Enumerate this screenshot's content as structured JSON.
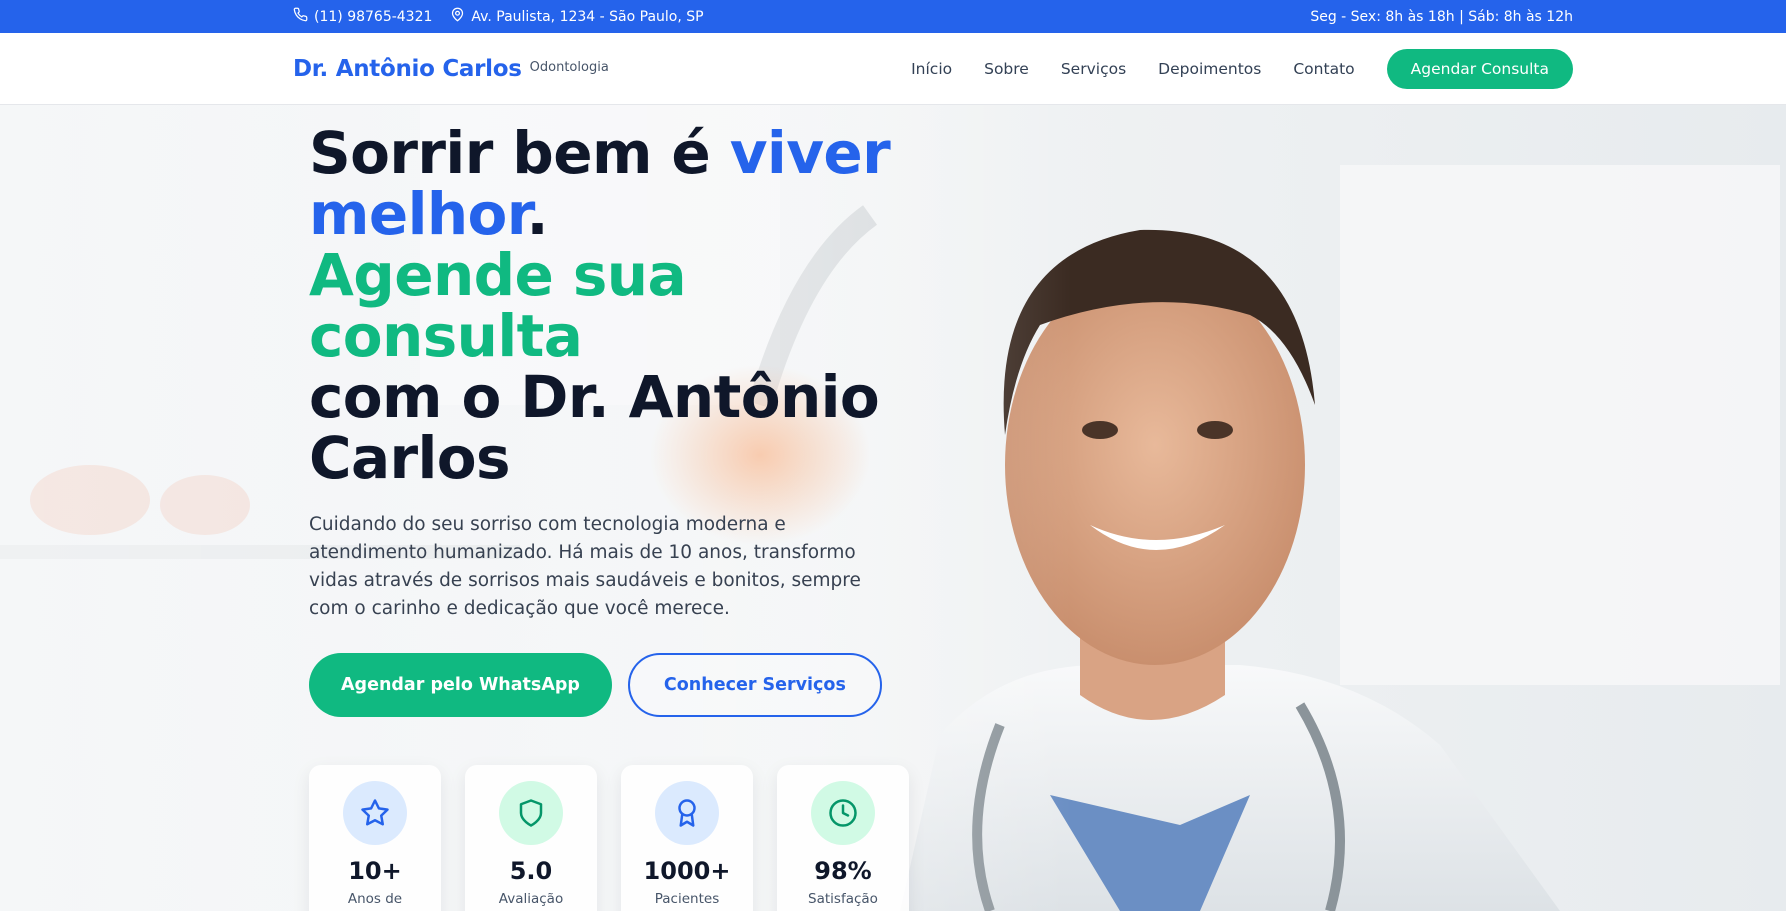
{
  "topbar": {
    "phone": "(11) 98765-4321",
    "address": "Av. Paulista, 1234 - São Paulo, SP",
    "hours": "Seg - Sex: 8h às 18h | Sáb: 8h às 12h",
    "phone_icon": "phone-icon",
    "address_icon": "map-pin-icon"
  },
  "header": {
    "brand_name": "Dr. Antônio Carlos",
    "brand_sub": "Odontologia",
    "nav": [
      "Início",
      "Sobre",
      "Serviços",
      "Depoimentos",
      "Contato"
    ],
    "cta": "Agendar Consulta"
  },
  "hero": {
    "headline_part1": "Sorrir bem é ",
    "headline_blue": "viver melhor",
    "headline_dot": ".",
    "headline_green": "Agende sua consulta",
    "headline_part2": "com o Dr. Antônio Carlos",
    "lead": "Cuidando do seu sorriso com tecnologia moderna e atendimento humanizado. Há mais de 10 anos, transformo vidas através de sorrisos mais saudáveis e bonitos, sempre com o carinho e dedicação que você merece.",
    "btn_whatsapp": "Agendar pelo WhatsApp",
    "btn_services": "Conhecer Serviços"
  },
  "stats": [
    {
      "icon": "star-icon",
      "value": "10+",
      "label": "Anos de Experiência"
    },
    {
      "icon": "shield-icon",
      "value": "5.0",
      "label": "Avaliação Média"
    },
    {
      "icon": "award-icon",
      "value": "1000+",
      "label": "Pacientes Atendidos"
    },
    {
      "icon": "clock-icon",
      "value": "98%",
      "label": "Satisfação"
    }
  ],
  "colors": {
    "primary_blue": "#2563eb",
    "accent_green": "#10b981",
    "text_dark": "#0f172a"
  }
}
